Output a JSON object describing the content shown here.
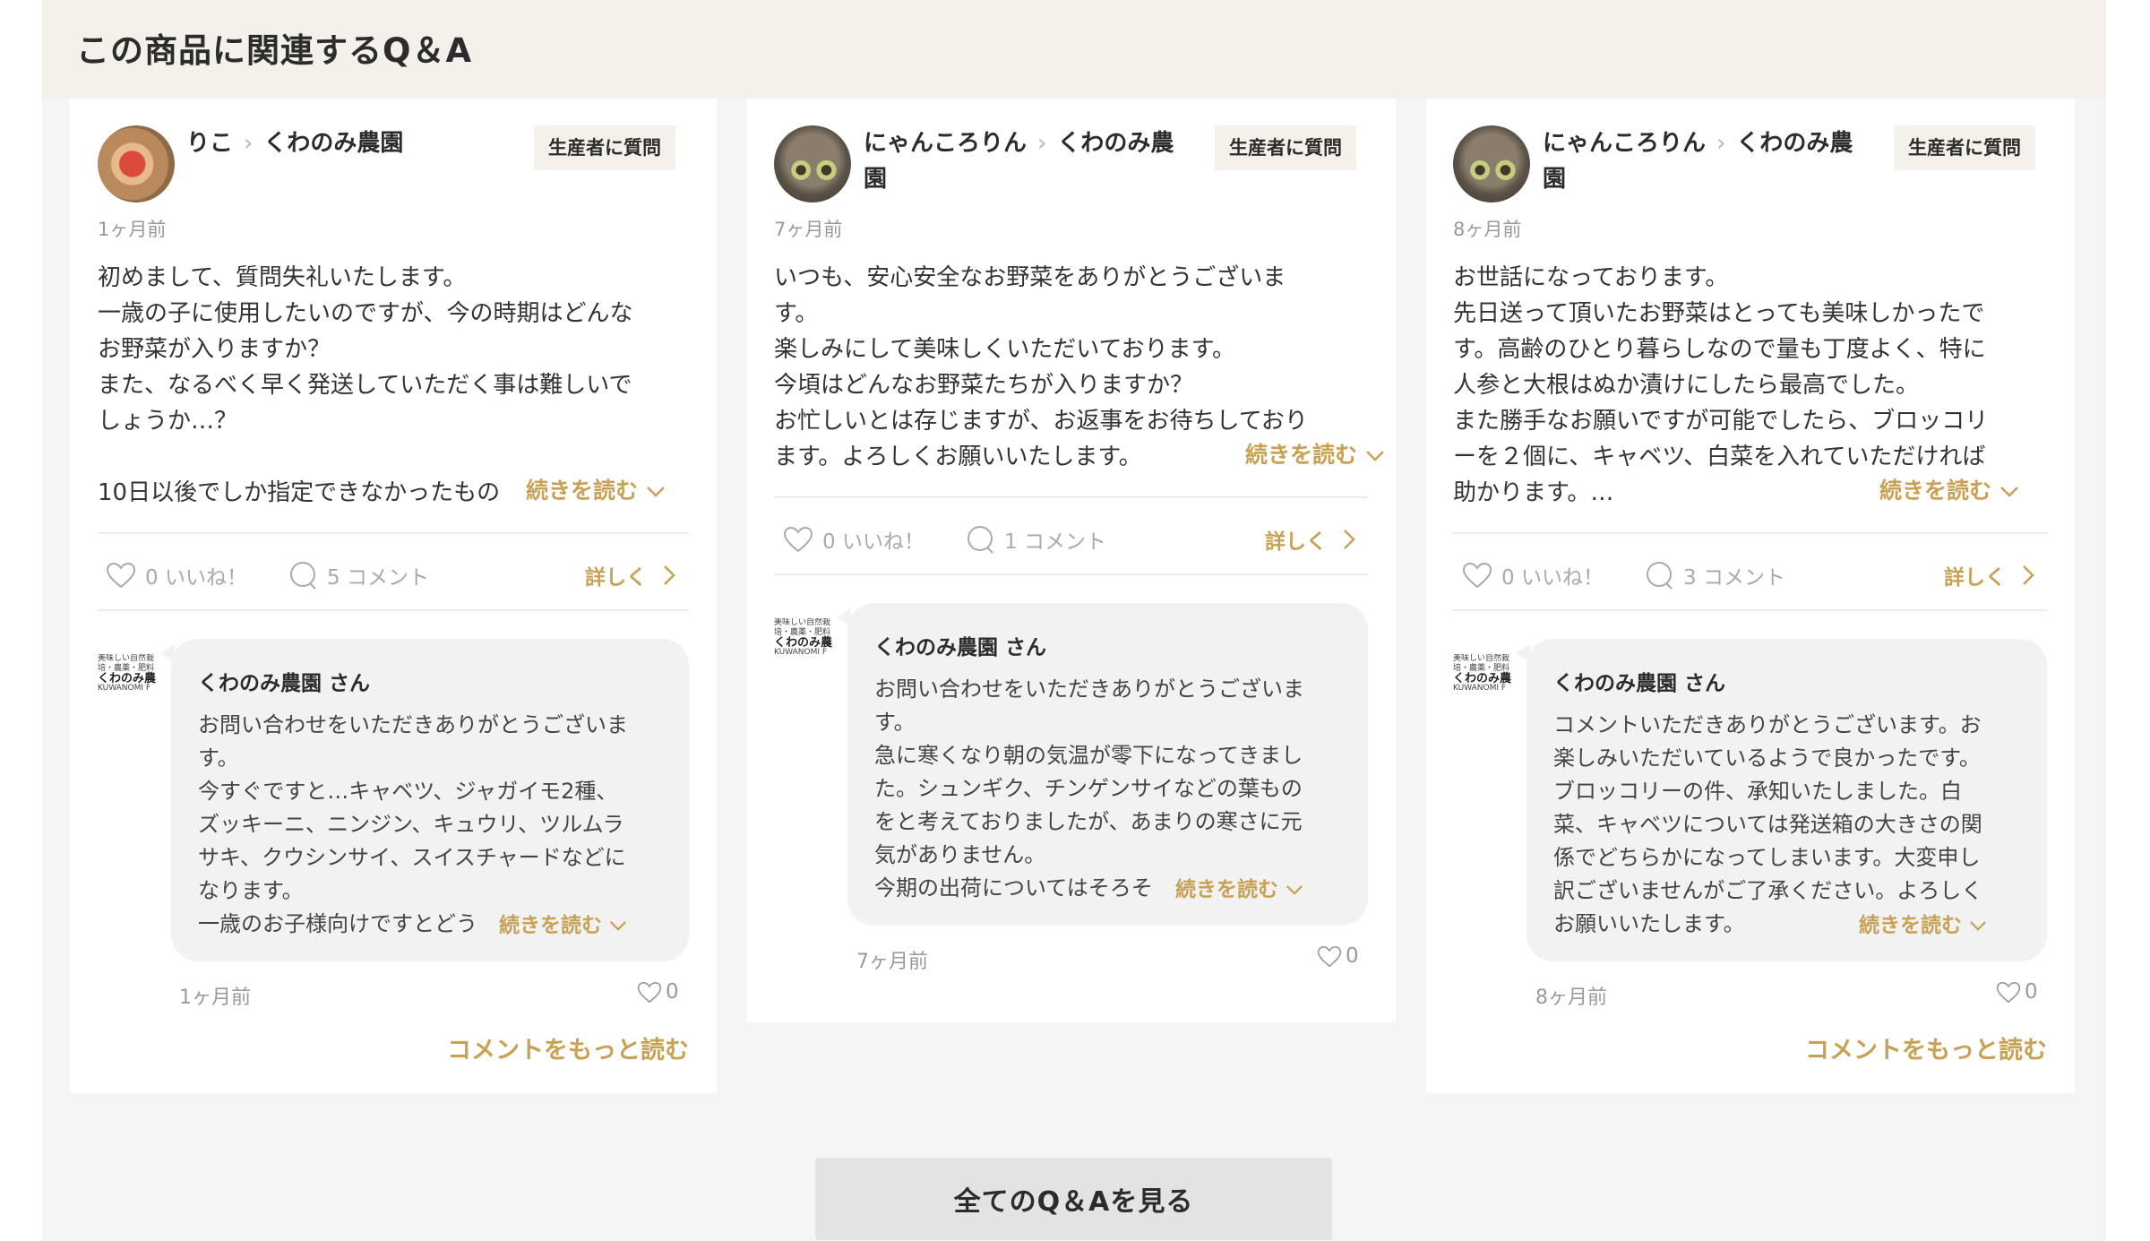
{
  "section_title": "この商品に関連するQ＆A",
  "ask_label": "生産者に質問",
  "read_more_label": "続きを読む",
  "detail_label": "詳しく",
  "more_comments_label": "コメントをもっと読む",
  "all_qa_label": "全てのQ＆Aを見る",
  "cards": [
    {
      "user": "りこ",
      "producer": "くわのみ農園",
      "time": "1ヶ月前",
      "body": [
        "初めまして、質問失礼いたします。",
        "一歳の子に使用したいのですが、今の時期はどんな",
        "お野菜が入りますか？",
        "また、なるべく早く発送していただく事は難しいで",
        "しょうか…？",
        "",
        "10日以後でしか指定できなかったもの"
      ],
      "likes": "0 いいね！",
      "comments": "5 コメント",
      "reply": {
        "name": "くわのみ農園 さん",
        "body": [
          "お問い合わせをいただきありがとうございま",
          "す。",
          "今すぐですと…キャベツ、ジャガイモ2種、",
          "ズッキーニ、ニンジン、キュウリ、ツルムラ",
          "サキ、クウシンサイ、スイスチャードなどに",
          "なります。",
          "一歳のお子様向けですとどう"
        ],
        "time": "1ヶ月前",
        "likes": "0"
      }
    },
    {
      "user": "にゃんころりん",
      "producer": "くわのみ農",
      "producer_cont": "園",
      "time": "7ヶ月前",
      "body": [
        "いつも、安心安全なお野菜をありがとうございま",
        "す。",
        "楽しみにして美味しくいただいております。",
        "今頃はどんなお野菜たちが入りますか？",
        "お忙しいとは存じますが、お返事をお待ちしており",
        "ます。よろしくお願いいたします。"
      ],
      "likes": "0 いいね！",
      "comments": "1 コメント",
      "reply": {
        "name": "くわのみ農園 さん",
        "body": [
          "お問い合わせをいただきありがとうございま",
          "す。",
          "急に寒くなり朝の気温が零下になってきまし",
          "た。シュンギク、チンゲンサイなどの葉もの",
          "をと考えておりましたが、あまりの寒さに元",
          "気がありません。",
          "今期の出荷についてはそろそ"
        ],
        "time": "7ヶ月前",
        "likes": "0"
      }
    },
    {
      "user": "にゃんころりん",
      "producer": "くわのみ農",
      "producer_cont": "園",
      "time": "8ヶ月前",
      "body": [
        "お世話になっております。",
        "先日送って頂いたお野菜はとっても美味しかったで",
        "す。高齢のひとり暮らしなので量も丁度よく、特に",
        "人参と大根はぬか漬けにしたら最高でした。",
        "また勝手なお願いですが可能でしたら、ブロッコリ",
        "ーを２個に、キャベツ、白菜を入れていただければ",
        "助かります。…"
      ],
      "likes": "0 いいね！",
      "comments": "3 コメント",
      "reply": {
        "name": "くわのみ農園 さん",
        "body": [
          "コメントいただきありがとうございます。お",
          "楽しみいただいているようで良かったです。",
          "ブロッコリーの件、承知いたしました。白",
          "菜、キャベツについては発送箱の大きさの関",
          "係でどちらかになってしまいます。大変申し",
          "訳ございませんがご了承ください。よろしく",
          "お願いいたします。"
        ],
        "time": "8ヶ月前",
        "likes": "0"
      }
    }
  ],
  "producer_logo": {
    "tagline": "美味しい自然栽培・農薬・肥料",
    "brand": "くわのみ農",
    "romaji": "KUWANOMI F"
  },
  "icons": {
    "heart": "heart-icon",
    "comment": "comment-bubble-icon",
    "chevron_right": "chevron-right-icon",
    "chevron_down": "chevron-down-icon"
  },
  "colors": {
    "accent": "#c8a155",
    "header_bg": "#f4f1ea",
    "bubble_bg": "#f2f2f2"
  }
}
